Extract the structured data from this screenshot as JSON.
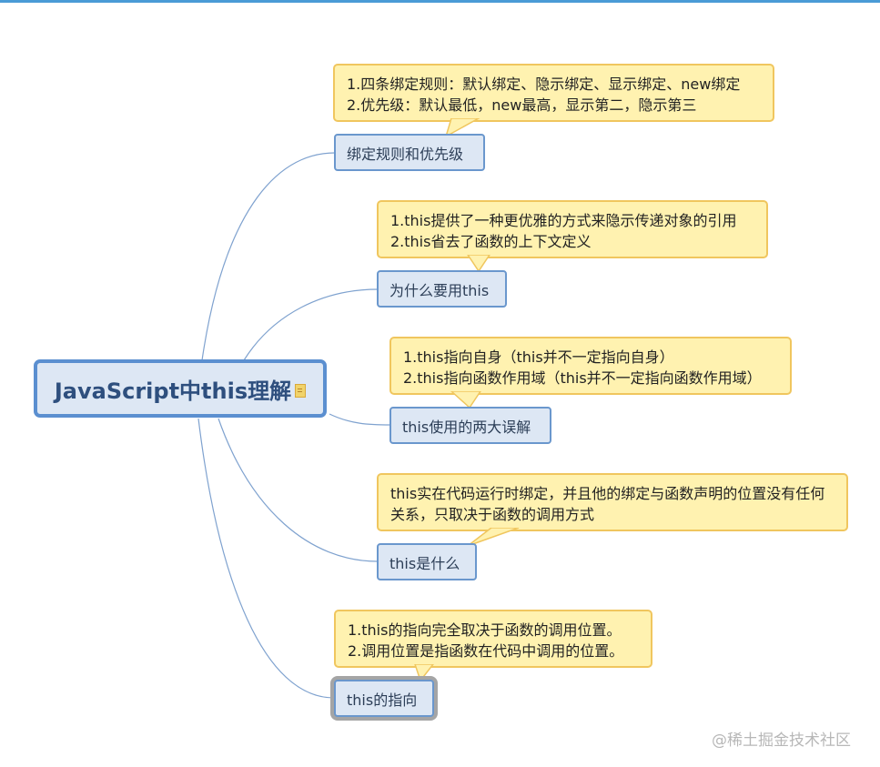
{
  "root": {
    "title": "JavaScript中this理解",
    "icon": "note-icon"
  },
  "branches": [
    {
      "label": "绑定规则和优先级",
      "callout": [
        "1.四条绑定规则：默认绑定、隐示绑定、显示绑定、new绑定",
        "2.优先级：默认最低，new最高，显示第二，隐示第三"
      ]
    },
    {
      "label": "为什么要用this",
      "callout": [
        "1.this提供了一种更优雅的方式来隐示传递对象的引用",
        "2.this省去了函数的上下文定义"
      ]
    },
    {
      "label": "this使用的两大误解",
      "callout": [
        "1.this指向自身（this并不一定指向自身）",
        "2.this指向函数作用域（this并不一定指向函数作用域）"
      ]
    },
    {
      "label": "this是什么",
      "callout": [
        "this实在代码运行时绑定，并且他的绑定与函数声明的位置没有任何关系，只取决于函数的调用方式"
      ]
    },
    {
      "label": "this的指向",
      "callout": [
        "1.this的指向完全取决于函数的调用位置。",
        "2.调用位置是指函数在代码中调用的位置。"
      ]
    }
  ],
  "watermark": "@稀土掘金技术社区",
  "colors": {
    "root_border": "#5b8fd0",
    "topic_fill": "#dde7f4",
    "callout_fill": "#fff2b0",
    "callout_border": "#f0c65e",
    "connector": "#7fa2cf"
  }
}
